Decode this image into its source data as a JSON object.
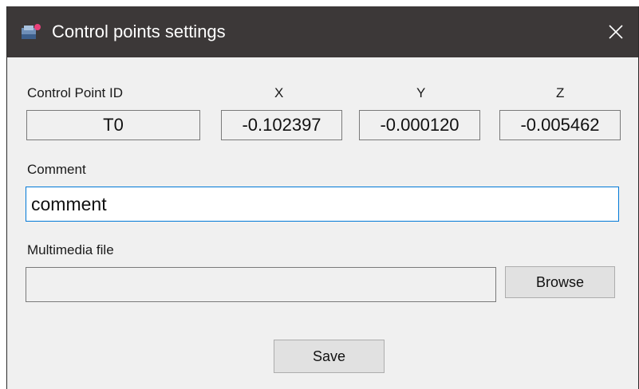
{
  "window": {
    "title": "Control points settings"
  },
  "fields": {
    "id_label": "Control Point ID",
    "id_value": "T0",
    "x_label": "X",
    "x_value": "-0.102397",
    "y_label": "Y",
    "y_value": "-0.000120",
    "z_label": "Z",
    "z_value": "-0.005462",
    "comment_label": "Comment",
    "comment_value": "comment",
    "multimedia_label": "Multimedia file",
    "multimedia_value": ""
  },
  "buttons": {
    "browse": "Browse",
    "save": "Save"
  },
  "icons": {
    "app": "app-icon",
    "close": "close-icon"
  },
  "colors": {
    "titlebar": "#3c3838",
    "background": "#f0f0f0",
    "focus_border": "#0078d7"
  }
}
